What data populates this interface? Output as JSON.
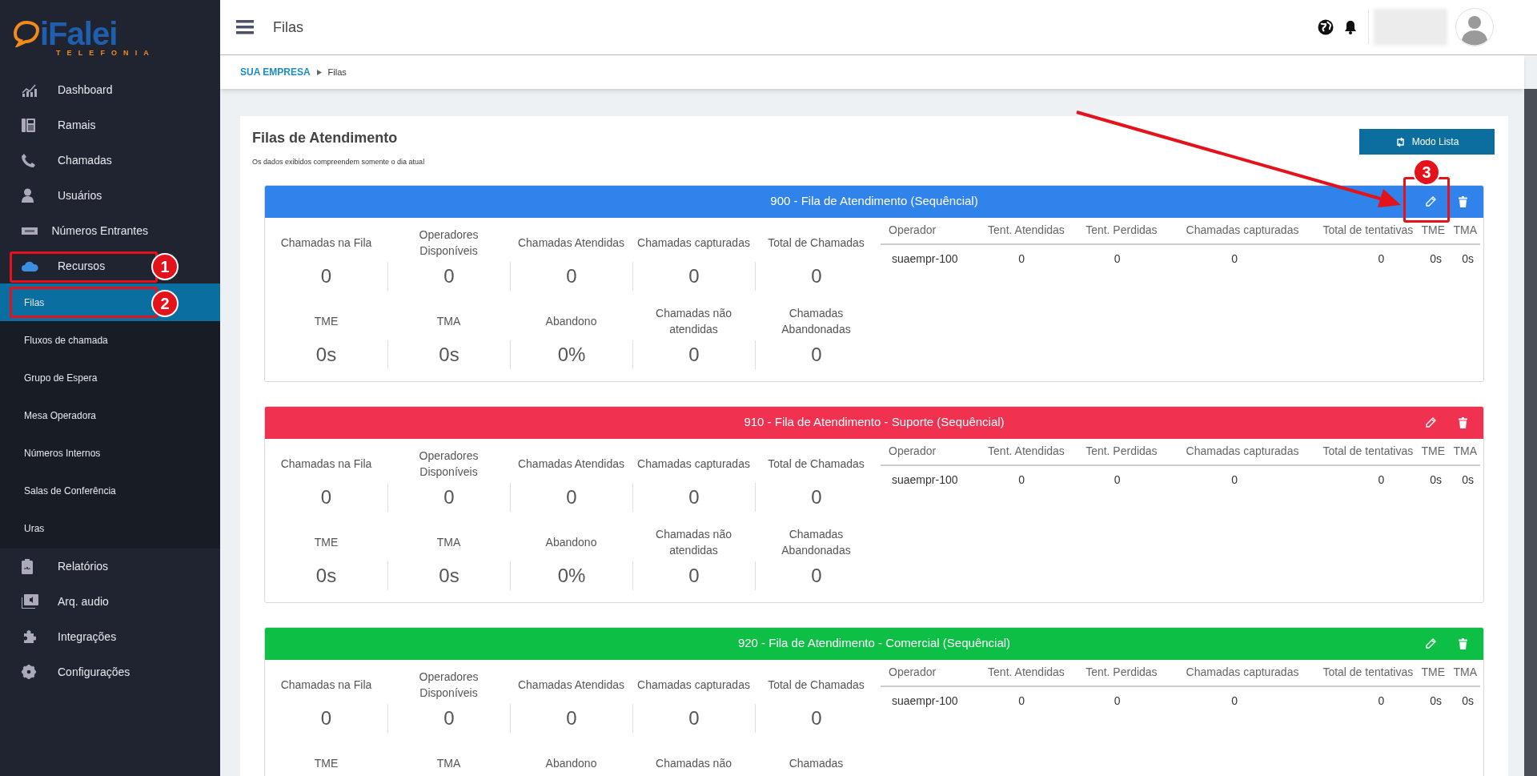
{
  "logo": {
    "brand": "iFalei",
    "tagline": "TELEFONIA"
  },
  "sidebar": {
    "items": [
      {
        "label": "Dashboard",
        "selected": false
      },
      {
        "label": "Ramais",
        "selected": false
      },
      {
        "label": "Chamadas",
        "selected": false
      },
      {
        "label": "Usuários",
        "selected": false
      },
      {
        "label": "Números Entrantes",
        "selected": false
      },
      {
        "label": "Recursos",
        "selected": false,
        "expanded": true,
        "children": [
          {
            "label": "Filas",
            "selected": true
          },
          {
            "label": "Fluxos de chamada",
            "selected": false
          },
          {
            "label": "Grupo de Espera",
            "selected": false
          },
          {
            "label": "Mesa Operadora",
            "selected": false
          },
          {
            "label": "Números Internos",
            "selected": false
          },
          {
            "label": "Salas de Conferência",
            "selected": false
          },
          {
            "label": "Uras",
            "selected": false
          }
        ]
      },
      {
        "label": "Relatórios",
        "selected": false
      },
      {
        "label": "Arq. audio",
        "selected": false
      },
      {
        "label": "Integrações",
        "selected": false
      },
      {
        "label": "Configurações",
        "selected": false
      }
    ]
  },
  "header": {
    "title": "Filas"
  },
  "breadcrumb": [
    {
      "label": "SUA EMPRESA",
      "kind": "link"
    },
    {
      "label": "Filas",
      "kind": "current"
    }
  ],
  "panel": {
    "title": "Filas de Atendimento",
    "subtitle": "Os dados exibidos compreendem somente o dia atual",
    "button": "Modo Lista"
  },
  "queues": [
    {
      "title": "900 - Fila de Atendimento (Sequêncial)",
      "color": "#3083ea",
      "stats": [
        {
          "label": "Chamadas na Fila",
          "value": "0"
        },
        {
          "label": "Operadores Disponíveis",
          "value": "0"
        },
        {
          "label": "Chamadas Atendidas",
          "value": "0"
        },
        {
          "label": "Chamadas capturadas",
          "value": "0"
        },
        {
          "label": "Total de Chamadas",
          "value": "0"
        },
        {
          "label": "TME",
          "value": "0s"
        },
        {
          "label": "TMA",
          "value": "0s"
        },
        {
          "label": "Abandono",
          "value": "0%"
        },
        {
          "label": "Chamadas não atendidas",
          "value": "0"
        },
        {
          "label": "Chamadas Abandonadas",
          "value": "0"
        }
      ],
      "columns": [
        "Operador",
        "Tent. Atendidas",
        "Tent. Perdidas",
        "Chamadas capturadas",
        "Total de tentativas",
        "TME",
        "TMA"
      ],
      "rows": [
        [
          "suaempr-100",
          "0",
          "0",
          "0",
          "0",
          "0s",
          "0s"
        ]
      ]
    },
    {
      "title": "910 - Fila de Atendimento - Suporte (Sequêncial)",
      "color": "#f03150",
      "stats": [
        {
          "label": "Chamadas na Fila",
          "value": "0"
        },
        {
          "label": "Operadores Disponíveis",
          "value": "0"
        },
        {
          "label": "Chamadas Atendidas",
          "value": "0"
        },
        {
          "label": "Chamadas capturadas",
          "value": "0"
        },
        {
          "label": "Total de Chamadas",
          "value": "0"
        },
        {
          "label": "TME",
          "value": "0s"
        },
        {
          "label": "TMA",
          "value": "0s"
        },
        {
          "label": "Abandono",
          "value": "0%"
        },
        {
          "label": "Chamadas não atendidas",
          "value": "0"
        },
        {
          "label": "Chamadas Abandonadas",
          "value": "0"
        }
      ],
      "columns": [
        "Operador",
        "Tent. Atendidas",
        "Tent. Perdidas",
        "Chamadas capturadas",
        "Total de tentativas",
        "TME",
        "TMA"
      ],
      "rows": [
        [
          "suaempr-100",
          "0",
          "0",
          "0",
          "0",
          "0s",
          "0s"
        ]
      ]
    },
    {
      "title": "920 - Fila de Atendimento - Comercial (Sequêncial)",
      "color": "#0dbf45",
      "stats": [
        {
          "label": "Chamadas na Fila",
          "value": "0"
        },
        {
          "label": "Operadores Disponíveis",
          "value": "0"
        },
        {
          "label": "Chamadas Atendidas",
          "value": "0"
        },
        {
          "label": "Chamadas capturadas",
          "value": "0"
        },
        {
          "label": "Total de Chamadas",
          "value": "0"
        },
        {
          "label": "TME"
        },
        {
          "label": "TMA"
        },
        {
          "label": "Abandono"
        },
        {
          "label": "Chamadas não"
        },
        {
          "label": "Chamadas"
        }
      ],
      "columns": [
        "Operador",
        "Tent. Atendidas",
        "Tent. Perdidas",
        "Chamadas capturadas",
        "Total de tentativas",
        "TME",
        "TMA"
      ],
      "rows": [
        [
          "suaempr-100",
          "0",
          "0",
          "0",
          "0",
          "0s",
          "0s"
        ]
      ]
    }
  ],
  "annotations": [
    {
      "number": "1"
    },
    {
      "number": "2"
    },
    {
      "number": "3"
    }
  ]
}
